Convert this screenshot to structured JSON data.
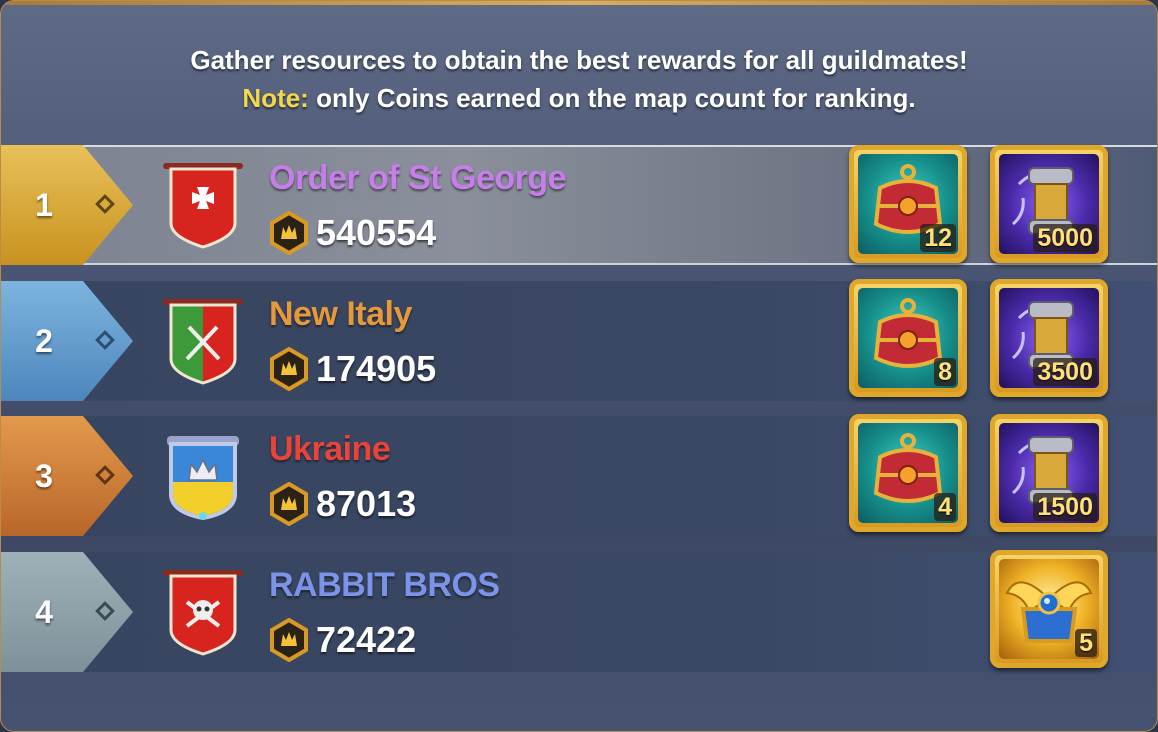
{
  "header": {
    "line1": "Gather resources to obtain the best rewards for all guildmates!",
    "note_label": "Note:",
    "note_text": " only Coins earned on the map count for ranking."
  },
  "rows": [
    {
      "rank": "1",
      "name": "Order of St George",
      "name_color": "#c77ee8",
      "score": "540554",
      "rank_color": "#d7a936",
      "rewards": [
        {
          "icon": "red-chest-icon",
          "qty": "12"
        },
        {
          "icon": "spell-scroll-icon",
          "qty": "5000"
        }
      ]
    },
    {
      "rank": "2",
      "name": "New Italy",
      "name_color": "#e5993a",
      "score": "174905",
      "rank_color": "#5c9bd0",
      "rewards": [
        {
          "icon": "red-chest-icon",
          "qty": "8"
        },
        {
          "icon": "spell-scroll-icon",
          "qty": "3500"
        }
      ]
    },
    {
      "rank": "3",
      "name": "Ukraine",
      "name_color": "#e8443a",
      "score": "87013",
      "rank_color": "#d17d34",
      "rewards": [
        {
          "icon": "red-chest-icon",
          "qty": "4"
        },
        {
          "icon": "spell-scroll-icon",
          "qty": "1500"
        }
      ]
    },
    {
      "rank": "4",
      "name": "RABBIT BROS",
      "name_color": "#7b93e8",
      "score": "72422",
      "rank_color": "#8c9fa8",
      "rewards": [
        {
          "icon": "golden-winged-chest-icon",
          "qty": "5"
        }
      ]
    }
  ],
  "colors": {
    "note": "#f3d84a",
    "panel_border": "#b98c47",
    "reward_frame": "#e0a82a"
  }
}
